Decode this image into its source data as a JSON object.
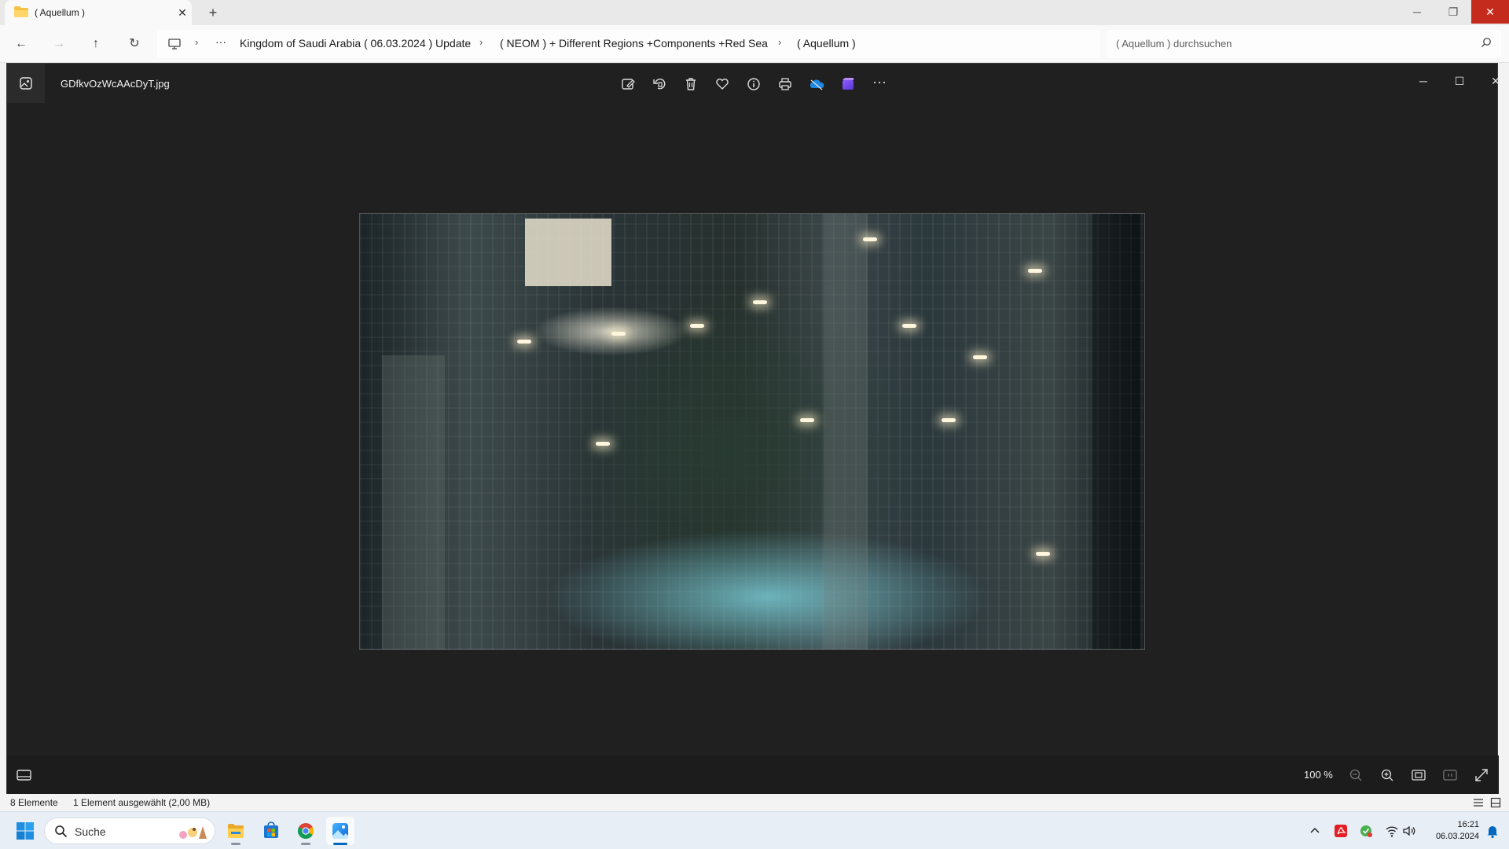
{
  "explorer": {
    "tab_title": "( Aquellum )",
    "new_tab": "+",
    "window_controls": {
      "minimize": "─",
      "restore": "❐",
      "close": "✕"
    },
    "nav": {
      "back": "←",
      "forward": "→",
      "up": "↑",
      "refresh": "↻"
    },
    "breadcrumb": {
      "more": "···",
      "items": [
        "Kingdom of Saudi Arabia ( 06.03.2024 ) Update",
        "( NEOM ) + Different Regions +Components +Red Sea",
        "( Aquellum )"
      ],
      "separator": "›"
    },
    "search": {
      "placeholder": "( Aquellum ) durchsuchen",
      "icon": "search-icon"
    },
    "status": {
      "item_count": "8 Elemente",
      "selection": "1 Element ausgewählt (2,00 MB)"
    }
  },
  "viewer": {
    "filename": "GDfkvOzWcAAcDyT.jpg",
    "toolbar": [
      "edit-icon",
      "rotate-icon",
      "delete-icon",
      "favorite-icon",
      "info-icon",
      "print-icon",
      "onedrive-icon",
      "clipchamp-icon",
      "more-icon"
    ],
    "more_label": "···",
    "window_controls": {
      "minimize": "─",
      "maximize": "☐",
      "close": "✕"
    },
    "zoom_level": "100 %"
  },
  "taskbar": {
    "search_label": "Suche",
    "apps": [
      "file-explorer-icon",
      "microsoft-store-icon",
      "chrome-icon",
      "photos-icon"
    ],
    "active_app": "photos-icon",
    "clock": {
      "time": "16:21",
      "date": "06.03.2024"
    }
  },
  "colors": {
    "viewer_bg": "#202020",
    "close_red": "#c42b1c",
    "accent": "#0067c0"
  }
}
